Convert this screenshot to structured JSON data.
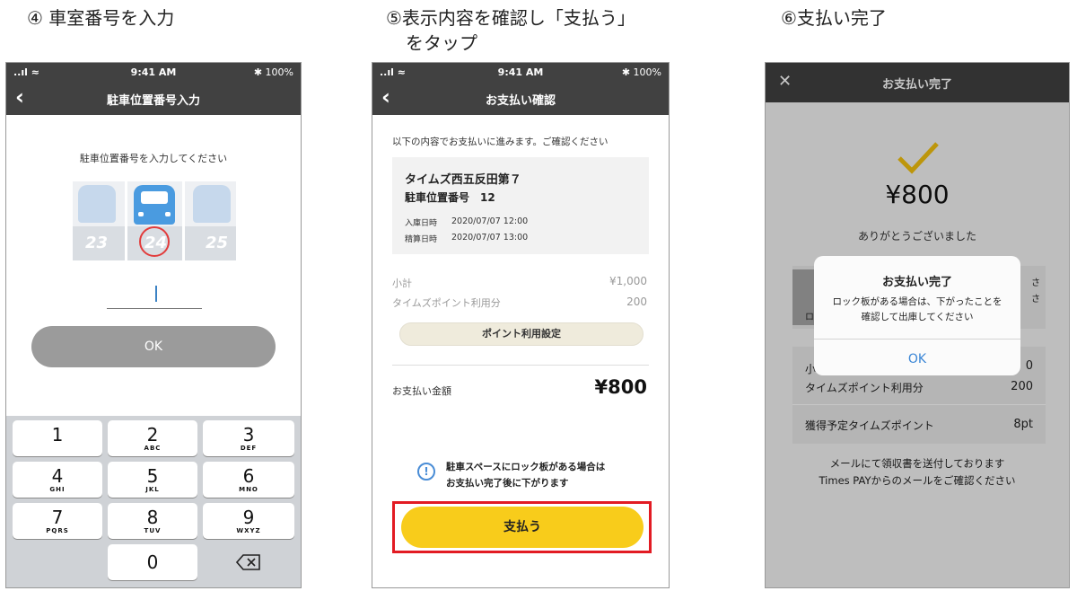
{
  "captions": {
    "step4": "④ 車室番号を入力",
    "step5_line1": "⑤表示内容を確認し「支払う」",
    "step5_line2": "をタップ",
    "step6": "⑥支払い完了"
  },
  "statusbar": {
    "signal": "..ıl ≈",
    "time": "9:41 AM",
    "battery": "✱ 100%"
  },
  "screen1": {
    "title": "駐車位置番号入力",
    "instruction": "駐車位置番号を入力してください",
    "slots": [
      "23",
      "24",
      "25"
    ],
    "ok_label": "OK",
    "keys": [
      {
        "num": "1",
        "letters": ""
      },
      {
        "num": "2",
        "letters": "ABC"
      },
      {
        "num": "3",
        "letters": "DEF"
      },
      {
        "num": "4",
        "letters": "GHI"
      },
      {
        "num": "5",
        "letters": "JKL"
      },
      {
        "num": "6",
        "letters": "MNO"
      },
      {
        "num": "7",
        "letters": "PQRS"
      },
      {
        "num": "8",
        "letters": "TUV"
      },
      {
        "num": "9",
        "letters": "WXYZ"
      },
      {
        "num": "0",
        "letters": ""
      }
    ]
  },
  "screen2": {
    "title": "お支払い確認",
    "intro": "以下の内容でお支払いに進みます。ご確認ください",
    "facility": "タイムズ西五反田第７",
    "slot_line": "駐車位置番号　12",
    "entry_label": "入庫日時",
    "entry_value": "2020/07/07 12:00",
    "settle_label": "精算日時",
    "settle_value": "2020/07/07 13:00",
    "subtotal_label": "小計",
    "subtotal_value": "¥1,000",
    "points_label": "タイムズポイント利用分",
    "points_value": "200",
    "points_button": "ポイント利用設定",
    "amount_label": "お支払い金額",
    "amount_value": "¥800",
    "notice_line1": "駐車スペースにロック板がある場合は",
    "notice_line2": "お支払い完了後に下がります",
    "pay_label": "支払う"
  },
  "screen3": {
    "title": "お支払い完了",
    "amount": "¥800",
    "thanks": "ありがとうございました",
    "partial_right1": "さ",
    "partial_right2": "さ",
    "partial_left": "ロ",
    "subtotal_partial_left": "小",
    "subtotal_partial_right": "0",
    "points_label": "タイムズポイント利用分",
    "points_value": "200",
    "earn_label": "獲得予定タイムズポイント",
    "earn_value": "8pt",
    "mail_line1": "メールにて領収書を送付しております",
    "mail_line2": "Times PAYからのメールをご確認ください",
    "dialog_title": "お支払い完了",
    "dialog_msg1": "ロック板がある場合は、下がったことを",
    "dialog_msg2": "確認して出庫してください",
    "dialog_ok": "OK"
  },
  "colors": {
    "accent_yellow": "#f8cc1b",
    "navbar": "#414141",
    "highlight_red": "#e21b23",
    "link_blue": "#3a86d6"
  }
}
